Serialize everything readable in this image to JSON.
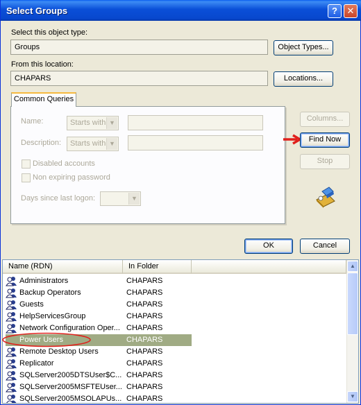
{
  "window": {
    "title": "Select Groups",
    "help_glyph": "?",
    "close_glyph": "✕"
  },
  "object_type": {
    "label": "Select this object type:",
    "value": "Groups",
    "button": "Object Types..."
  },
  "location": {
    "label": "From this location:",
    "value": "CHAPARS",
    "button": "Locations..."
  },
  "queries": {
    "tab": "Common Queries",
    "name_label": "Name:",
    "description_label": "Description:",
    "starts_with": "Starts with",
    "disabled_accounts": "Disabled accounts",
    "non_expiring": "Non expiring password",
    "days_label": "Days since last logon:"
  },
  "side_buttons": {
    "columns": "Columns...",
    "find_now": "Find Now",
    "stop": "Stop"
  },
  "dialog_buttons": {
    "ok": "OK",
    "cancel": "Cancel"
  },
  "results": {
    "columns": [
      "Name (RDN)",
      "In Folder"
    ],
    "rows": [
      {
        "name": "Administrators",
        "folder": "CHAPARS"
      },
      {
        "name": "Backup Operators",
        "folder": "CHAPARS"
      },
      {
        "name": "Guests",
        "folder": "CHAPARS"
      },
      {
        "name": "HelpServicesGroup",
        "folder": "CHAPARS"
      },
      {
        "name": "Network Configuration Oper...",
        "folder": "CHAPARS"
      },
      {
        "name": "Power Users",
        "folder": "CHAPARS",
        "selected": true
      },
      {
        "name": "Remote Desktop Users",
        "folder": "CHAPARS"
      },
      {
        "name": "Replicator",
        "folder": "CHAPARS"
      },
      {
        "name": "SQLServer2005DTSUser$C...",
        "folder": "CHAPARS"
      },
      {
        "name": "SQLServer2005MSFTEUser...",
        "folder": "CHAPARS"
      },
      {
        "name": "SQLServer2005MSOLAPUs...",
        "folder": "CHAPARS"
      }
    ]
  },
  "icons": {
    "group": "group-icon",
    "search": "search-flashlight-icon",
    "pointer": "red-arrow-annotation"
  },
  "colors": {
    "selection": "#a0ab84",
    "annotation": "#e0201c"
  }
}
